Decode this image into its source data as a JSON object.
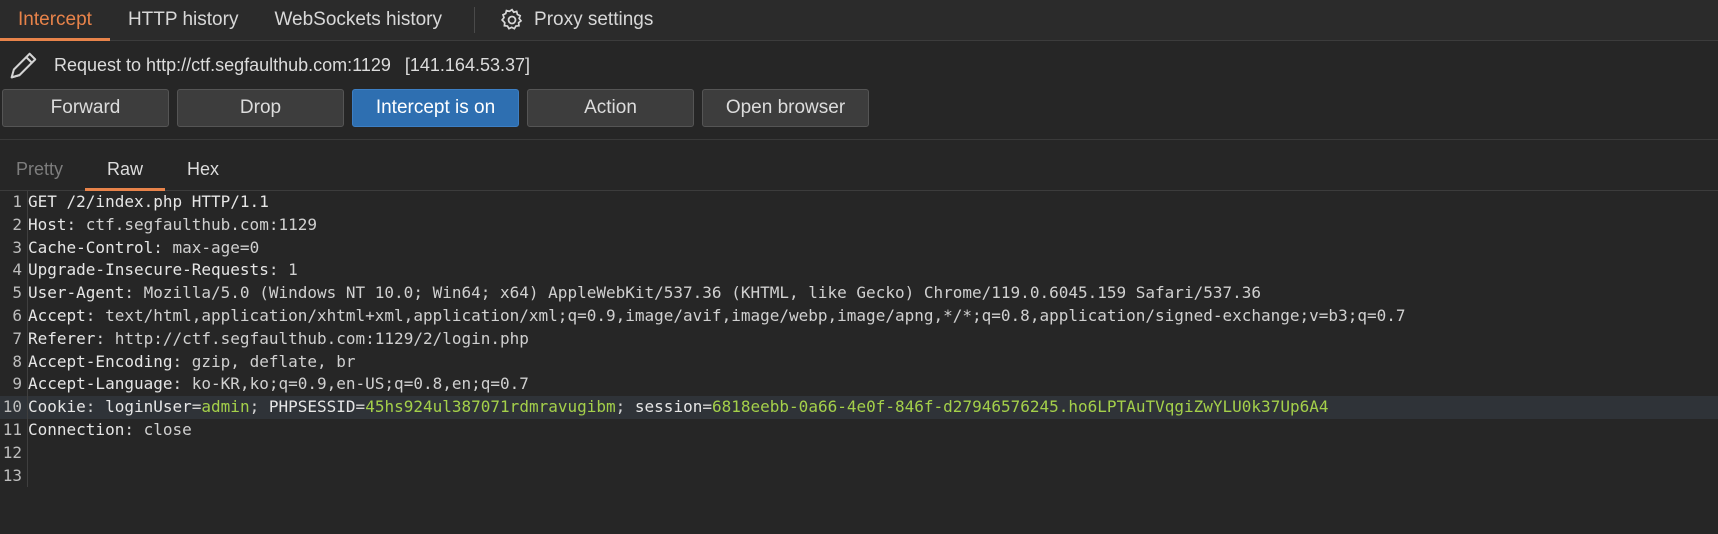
{
  "tabs": [
    {
      "label": "Intercept",
      "active": true
    },
    {
      "label": "HTTP history",
      "active": false
    },
    {
      "label": "WebSockets history",
      "active": false
    }
  ],
  "proxy_settings": {
    "label": "Proxy settings",
    "icon": "gear-icon"
  },
  "request": {
    "prefix": "Request to http://ctf.segfaulthub.com:1129",
    "ip": "[141.164.53.37]",
    "icon": "pencil-icon"
  },
  "toolbar": {
    "forward": "Forward",
    "drop": "Drop",
    "intercept": "Intercept is on",
    "action": "Action",
    "open_browser": "Open browser"
  },
  "editor_tabs": [
    "Pretty",
    "Raw",
    "Hex"
  ],
  "editor_active_tab": "Raw",
  "lines": [
    {
      "n": "1",
      "name": "GET /2/index.php HTTP/1.1",
      "val": ""
    },
    {
      "n": "2",
      "name": "Host",
      "val": "ctf.segfaulthub.com:1129"
    },
    {
      "n": "3",
      "name": "Cache-Control",
      "val": "max-age=0"
    },
    {
      "n": "4",
      "name": "Upgrade-Insecure-Requests",
      "val": "1"
    },
    {
      "n": "5",
      "name": "User-Agent",
      "val": "Mozilla/5.0 (Windows NT 10.0; Win64; x64) AppleWebKit/537.36 (KHTML, like Gecko) Chrome/119.0.6045.159 Safari/537.36"
    },
    {
      "n": "6",
      "name": "Accept",
      "val": "text/html,application/xhtml+xml,application/xml;q=0.9,image/avif,image/webp,image/apng,*/*;q=0.8,application/signed-exchange;v=b3;q=0.7"
    },
    {
      "n": "7",
      "name": "Referer",
      "val": "http://ctf.segfaulthub.com:1129/2/login.php"
    },
    {
      "n": "8",
      "name": "Accept-Encoding",
      "val": "gzip, deflate, br"
    },
    {
      "n": "9",
      "name": "Accept-Language",
      "val": "ko-KR,ko;q=0.9,en-US;q=0.8,en;q=0.7"
    },
    {
      "n": "10",
      "name": "Cookie",
      "cookie": [
        {
          "k": "loginUser",
          "v": "admin"
        },
        {
          "k": "PHPSESSID",
          "v": "45hs924ul387071rdmravugibm"
        },
        {
          "k": "session",
          "v": "6818eebb-0a66-4e0f-846f-d27946576245.ho6LPTAuTVqgiZwYLU0k37Up6A4"
        }
      ]
    },
    {
      "n": "11",
      "name": "Connection",
      "val": "close"
    },
    {
      "n": "12",
      "name": "",
      "val": ""
    },
    {
      "n": "13",
      "name": "",
      "val": ""
    }
  ],
  "colors": {
    "accent": "#e8834a",
    "primary_button": "#2e6fb1",
    "cookie_value": "#a4d04a"
  }
}
